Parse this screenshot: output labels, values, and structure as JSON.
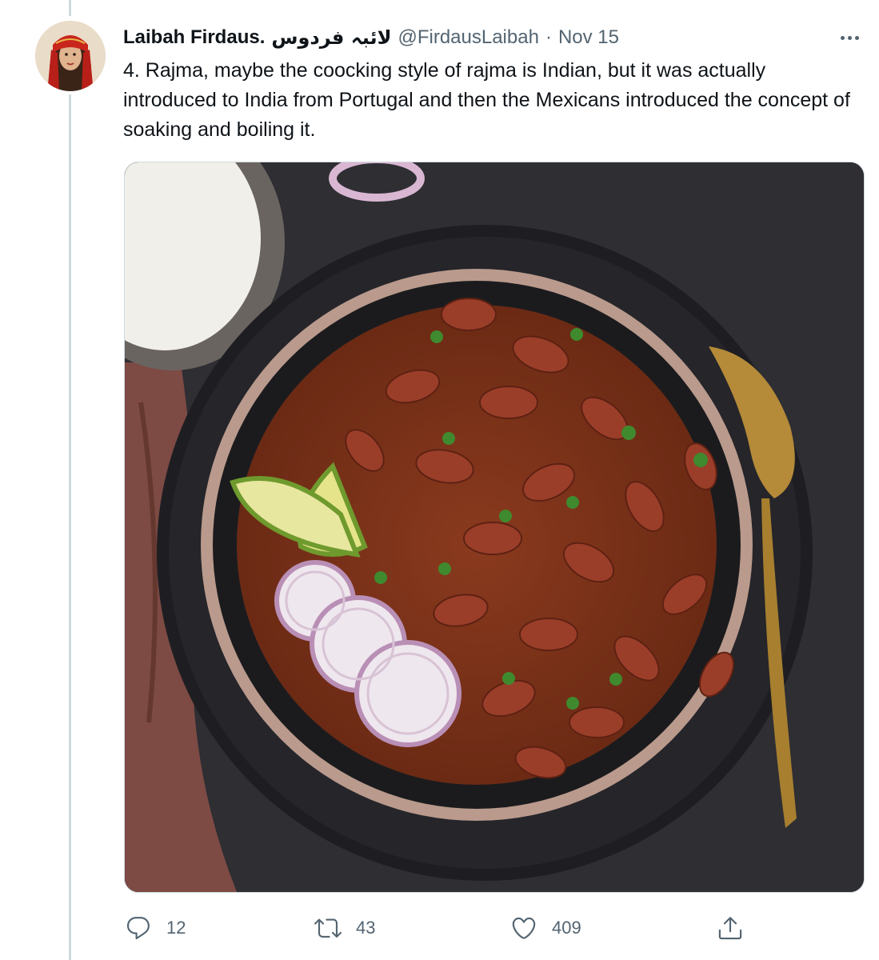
{
  "tweet": {
    "display_name": "Laibah Firdaus.",
    "display_name_urdu": "لائبہ فردوس",
    "handle": "@FirdausLaibah",
    "separator": "·",
    "date": "Nov 15",
    "text": "4. Rajma, maybe the coocking style of rajma is Indian, but it was actually introduced to India from Portugal and then the Mexicans introduced the concept of soaking and boiling it.",
    "media": {
      "icon": "photo-of-rajma-bowl"
    }
  },
  "actions": {
    "reply": {
      "icon": "reply-icon",
      "count": "12"
    },
    "retweet": {
      "icon": "retweet-icon",
      "count": "43"
    },
    "like": {
      "icon": "heart-icon",
      "count": "409"
    },
    "share": {
      "icon": "share-icon"
    }
  },
  "colors": {
    "text_primary": "#0f1419",
    "text_secondary": "#536471",
    "thread_line": "#cfd9de"
  }
}
